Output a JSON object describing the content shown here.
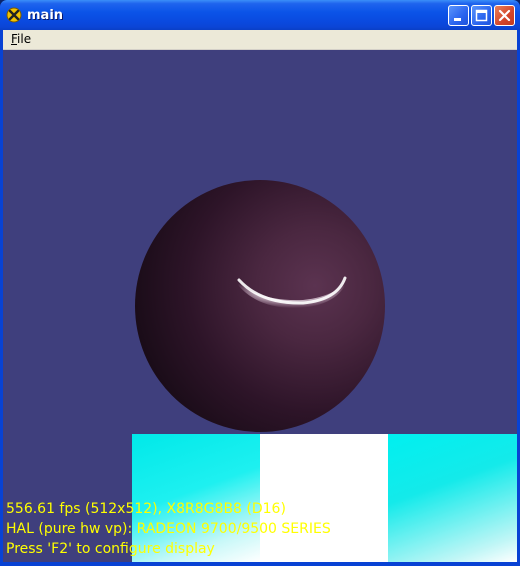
{
  "window": {
    "title": "main",
    "icon": "directx-x-icon",
    "buttons": [
      "minimize-button",
      "maximize-button",
      "close-button"
    ]
  },
  "menu": {
    "file_prefix": "F",
    "file_rest": "ile"
  },
  "viewport": {
    "background_color": "#3f3f7d",
    "stats": {
      "line1": "556.61 fps (512x512), X8R8G8B8 (D16)",
      "line2": "HAL (pure hw vp): RADEON 9700/9500 SERIES",
      "line3": "Press 'F2' to configure display"
    },
    "text_color": "#ffff00"
  }
}
